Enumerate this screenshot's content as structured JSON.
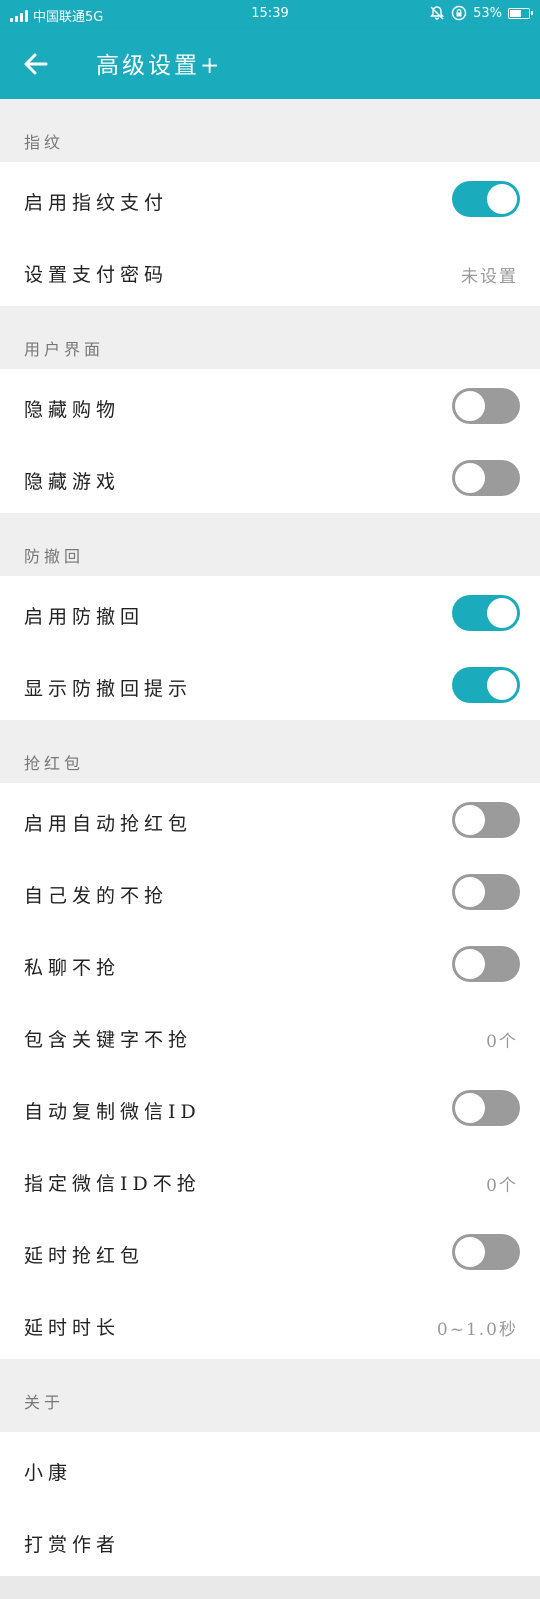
{
  "status_bar": {
    "carrier": "中国联通5G",
    "time": "15:39",
    "battery": "53%",
    "battery_level": 0.53
  },
  "app_bar": {
    "back_icon": "arrow-left-icon",
    "title": "高级设置+"
  },
  "colors": {
    "accent": "#1aabbd",
    "toggle_off": "#9b9b9b",
    "section_bg": "#efefef"
  },
  "sections": {
    "fingerprint": {
      "header": "指纹",
      "enable_pay": {
        "label": "启用指纹支付",
        "on": true
      },
      "set_password": {
        "label": "设置支付密码",
        "value": "未设置"
      }
    },
    "ui": {
      "header": "用户界面",
      "hide_shopping": {
        "label": "隐藏购物",
        "on": false
      },
      "hide_games": {
        "label": "隐藏游戏",
        "on": false
      }
    },
    "anti_recall": {
      "header": "防撤回",
      "enable": {
        "label": "启用防撤回",
        "on": true
      },
      "show_hint": {
        "label": "显示防撤回提示",
        "on": true
      }
    },
    "red_packet": {
      "header": "抢红包",
      "auto_grab": {
        "label": "启用自动抢红包",
        "on": false
      },
      "skip_own": {
        "label": "自己发的不抢",
        "on": false
      },
      "skip_private": {
        "label": "私聊不抢",
        "on": false
      },
      "skip_keywords": {
        "label": "包含关键字不抢",
        "value": "0个"
      },
      "auto_copy_id": {
        "label": "自动复制微信ID",
        "on": false
      },
      "skip_ids": {
        "label": "指定微信ID不抢",
        "value": "0个"
      },
      "delay_grab": {
        "label": "延时抢红包",
        "on": false
      },
      "delay_duration": {
        "label": "延时时长",
        "value": "0~1.0秒"
      }
    },
    "about": {
      "header": "关于",
      "author": {
        "label": "小康"
      },
      "donate": {
        "label": "打赏作者"
      }
    }
  }
}
